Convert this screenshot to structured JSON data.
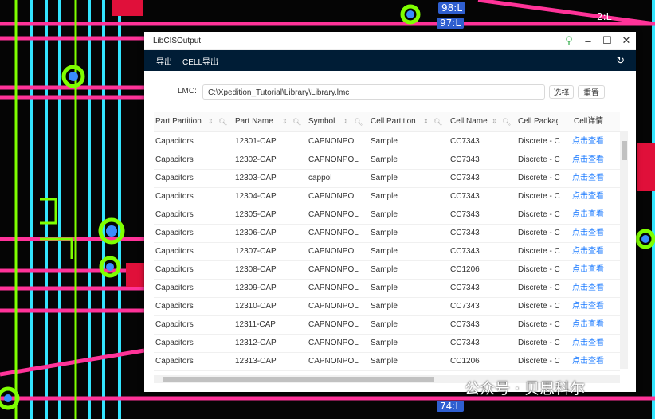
{
  "window": {
    "title": "LibCISOutput",
    "pin_icon": "pin-icon",
    "minimize": "–",
    "maximize": "☐",
    "close": "✕"
  },
  "menu": {
    "export_label": "导出",
    "cell_export_label": "CELL导出",
    "refresh": "↻"
  },
  "lmc": {
    "label": "LMC:",
    "value": "C:\\Xpedition_Tutorial\\Library\\Library.lmc",
    "select_label": "选择",
    "reset_label": "重置"
  },
  "table": {
    "headers": [
      "Part Partition",
      "Part Name",
      "Symbol",
      "Cell Partition",
      "Cell Name",
      "Cell Package",
      "Cell详情"
    ],
    "rows": [
      [
        "Capacitors",
        "12301-CAP",
        "CAPNONPOL",
        "Sample",
        "CC7343",
        "Discrete - C",
        "点击查看"
      ],
      [
        "Capacitors",
        "12302-CAP",
        "CAPNONPOL",
        "Sample",
        "CC7343",
        "Discrete - C",
        "点击查看"
      ],
      [
        "Capacitors",
        "12303-CAP",
        "cappol",
        "Sample",
        "CC7343",
        "Discrete - C",
        "点击查看"
      ],
      [
        "Capacitors",
        "12304-CAP",
        "CAPNONPOL",
        "Sample",
        "CC7343",
        "Discrete - C",
        "点击查看"
      ],
      [
        "Capacitors",
        "12305-CAP",
        "CAPNONPOL",
        "Sample",
        "CC7343",
        "Discrete - C",
        "点击查看"
      ],
      [
        "Capacitors",
        "12306-CAP",
        "CAPNONPOL",
        "Sample",
        "CC7343",
        "Discrete - C",
        "点击查看"
      ],
      [
        "Capacitors",
        "12307-CAP",
        "CAPNONPOL",
        "Sample",
        "CC7343",
        "Discrete - C",
        "点击查看"
      ],
      [
        "Capacitors",
        "12308-CAP",
        "CAPNONPOL",
        "Sample",
        "CC1206",
        "Discrete - C",
        "点击查看"
      ],
      [
        "Capacitors",
        "12309-CAP",
        "CAPNONPOL",
        "Sample",
        "CC7343",
        "Discrete - C",
        "点击查看"
      ],
      [
        "Capacitors",
        "12310-CAP",
        "CAPNONPOL",
        "Sample",
        "CC7343",
        "Discrete - C",
        "点击查看"
      ],
      [
        "Capacitors",
        "12311-CAP",
        "CAPNONPOL",
        "Sample",
        "CC7343",
        "Discrete - C",
        "点击查看"
      ],
      [
        "Capacitors",
        "12312-CAP",
        "CAPNONPOL",
        "Sample",
        "CC7343",
        "Discrete - C",
        "点击查看"
      ],
      [
        "Capacitors",
        "12313-CAP",
        "CAPNONPOL",
        "Sample",
        "CC1206",
        "Discrete - C",
        "点击查看"
      ]
    ]
  },
  "background": {
    "labels": [
      "98:L",
      "97:L",
      "2:L",
      "74:L"
    ],
    "watermark": "公众号 · 贝思科尔"
  },
  "colors": {
    "menubar": "#001d36",
    "link": "#1677ff",
    "trace_pink": "#ff3399",
    "trace_cyan": "#33e5ff",
    "trace_green": "#7fff00"
  }
}
